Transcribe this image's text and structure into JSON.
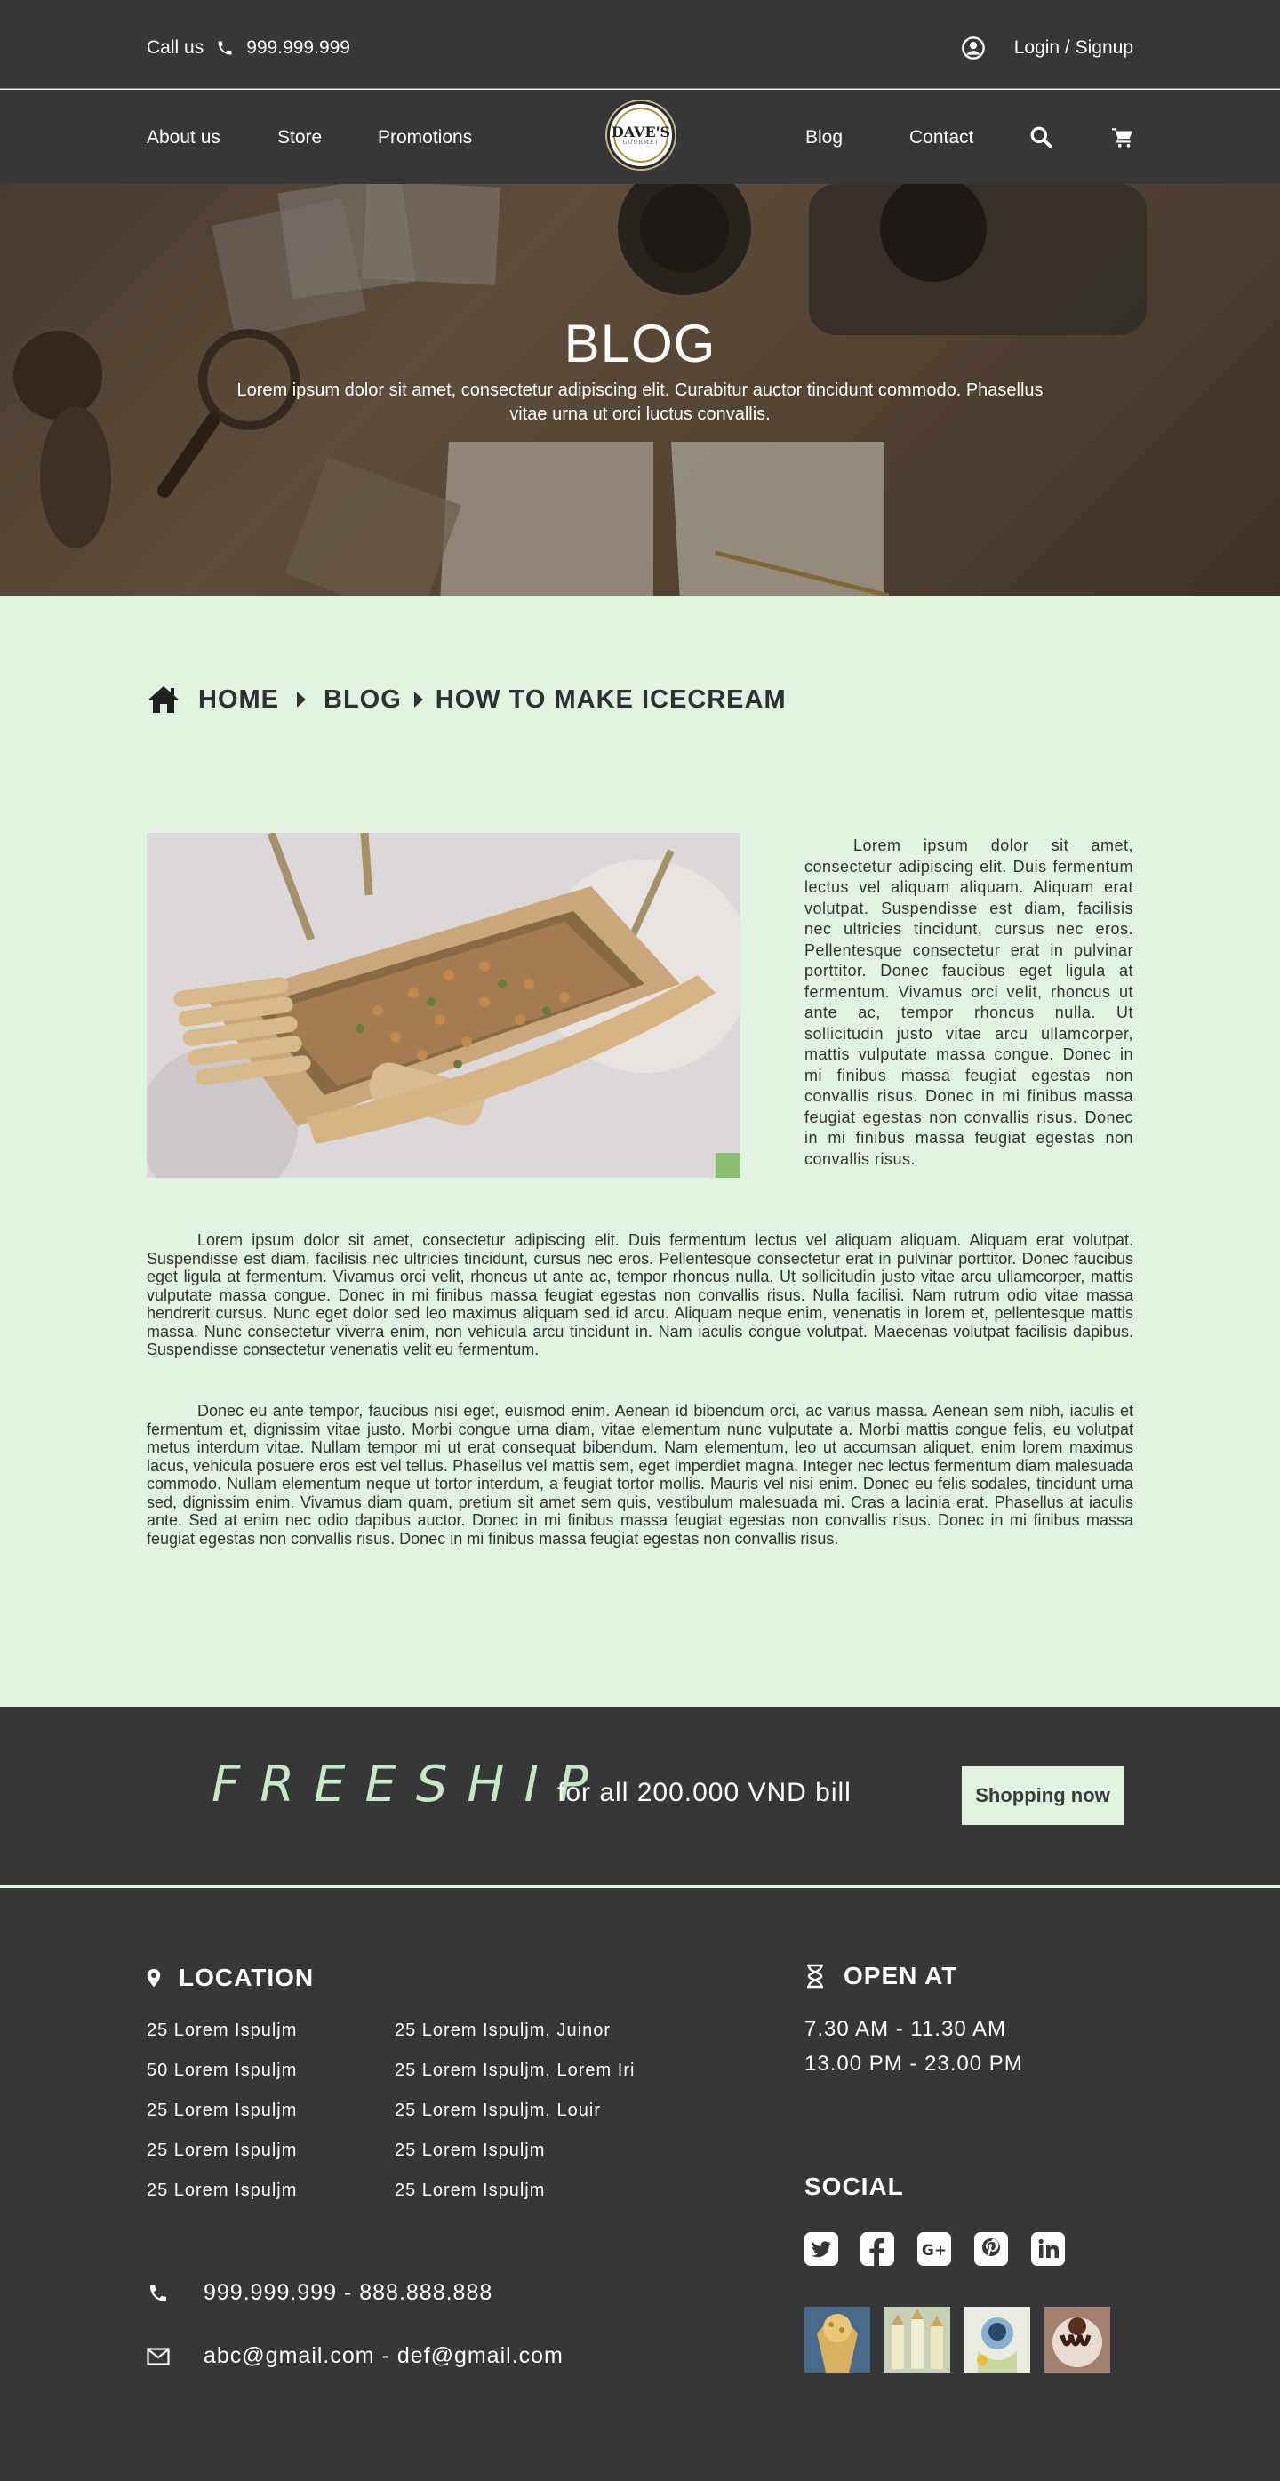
{
  "topbar": {
    "call_label": "Call us",
    "phone": "999.999.999",
    "login": "Login / Signup"
  },
  "nav": {
    "about": "About us",
    "store": "Store",
    "promotions": "Promotions",
    "blog": "Blog",
    "contact": "Contact",
    "logo_name": "DAVE'S",
    "logo_sub": "GOURMET"
  },
  "hero": {
    "title": "BLOG",
    "subtitle": "Lorem ipsum dolor sit amet, consectetur adipiscing elit. Curabitur auctor tincidunt commodo. Phasellus vitae urna ut orci luctus convallis."
  },
  "breadcrumb": {
    "home": "HOME",
    "blog": "BLOG",
    "current": "HOW TO MAKE ICECREAM"
  },
  "article": {
    "side_text": "Lorem ipsum dolor sit amet, consectetur adipiscing elit. Duis fermentum lectus vel aliquam aliquam. Aliquam erat volutpat. Suspendisse est diam, facilisis nec ultricies tincidunt, cursus nec eros. Pellentesque consectetur erat in pulvinar porttitor. Donec faucibus eget ligula at fermentum. Vivamus orci velit, rhoncus ut ante ac, tempor rhoncus nulla. Ut sollicitudin justo vitae arcu ullamcorper, mattis vulputate massa congue. Donec in mi finibus massa feugiat egestas non convallis risus. Donec in mi finibus massa feugiat egestas non convallis risus. Donec in mi finibus massa feugiat egestas non convallis risus.",
    "paragraph1": "Lorem ipsum dolor sit amet, consectetur adipiscing elit. Duis fermentum lectus vel aliquam aliquam. Aliquam erat volutpat. Suspendisse est diam, facilisis nec ultricies tincidunt, cursus nec eros. Pellentesque consectetur erat in pulvinar porttitor. Donec faucibus eget ligula at fermentum. Vivamus orci velit, rhoncus ut ante ac, tempor rhoncus nulla. Ut sollicitudin justo vitae arcu ullamcorper, mattis vulputate massa congue. Donec in mi finibus massa feugiat egestas non convallis risus. Nulla facilisi. Nam rutrum odio vitae massa hendrerit cursus. Nunc eget dolor sed leo maximus aliquam sed id arcu. Aliquam neque enim, venenatis in lorem et, pellentesque mattis massa. Nunc consectetur viverra enim, non vehicula arcu tincidunt in. Nam iaculis congue volutpat. Maecenas volutpat facilisis dapibus. Suspendisse consectetur venenatis velit eu fermentum.",
    "paragraph2": "Donec eu ante tempor, faucibus nisi eget, euismod enim. Aenean id bibendum orci, ac varius massa. Aenean sem nibh, iaculis et fermentum et, dignissim vitae justo. Morbi congue urna diam, vitae elementum nunc vulputate a. Morbi mattis congue felis, eu volutpat metus interdum vitae. Nullam tempor mi ut erat consequat bibendum. Nam elementum, leo ut accumsan aliquet, enim lorem maximus lacus, vehicula posuere eros est vel tellus. Phasellus vel mattis sem, eget imperdiet magna. Integer nec lectus fermentum diam malesuada commodo. Nullam elementum neque ut tortor interdum, a feugiat tortor mollis. Mauris vel nisi enim. Donec eu felis sodales, tincidunt urna sed, dignissim enim. Vivamus diam quam, pretium sit amet sem quis, vestibulum malesuada mi. Cras a lacinia erat. Phasellus at iaculis ante. Sed at enim nec odio dapibus auctor. Donec in mi finibus massa feugiat egestas non convallis risus. Donec in mi finibus massa feugiat egestas non convallis risus. Donec in mi finibus massa feugiat egestas non convallis risus."
  },
  "promo": {
    "word": "FREESHIP",
    "text": "for all 200.000 VND bill",
    "button": "Shopping now"
  },
  "footer": {
    "location_title": "LOCATION",
    "locations_left": [
      "25 Lorem Ispuljm",
      "50 Lorem Ispuljm",
      "25 Lorem Ispuljm",
      "25 Lorem Ispuljm",
      "25 Lorem Ispuljm"
    ],
    "locations_right": [
      "25 Lorem Ispuljm, Juinor",
      "25 Lorem Ispuljm, Lorem Iri",
      "25 Lorem Ispuljm, Louir",
      "25 Lorem Ispuljm",
      "25 Lorem Ispuljm"
    ],
    "open_title": "OPEN AT",
    "open_times": [
      "7.30 AM  - 11.30 AM",
      "13.00 PM  - 23.00 PM"
    ],
    "social_title": "SOCIAL",
    "social_icons": [
      "twitter-icon",
      "facebook-icon",
      "google-plus-icon",
      "pinterest-icon",
      "linkedin-icon"
    ],
    "phone": "999.999.999 - 888.888.888",
    "email": "abc@gmail.com - def@gmail.com"
  },
  "colors": {
    "dark": "#363739",
    "mint": "#e0f2e0",
    "freeship": "#c7e8c4"
  }
}
